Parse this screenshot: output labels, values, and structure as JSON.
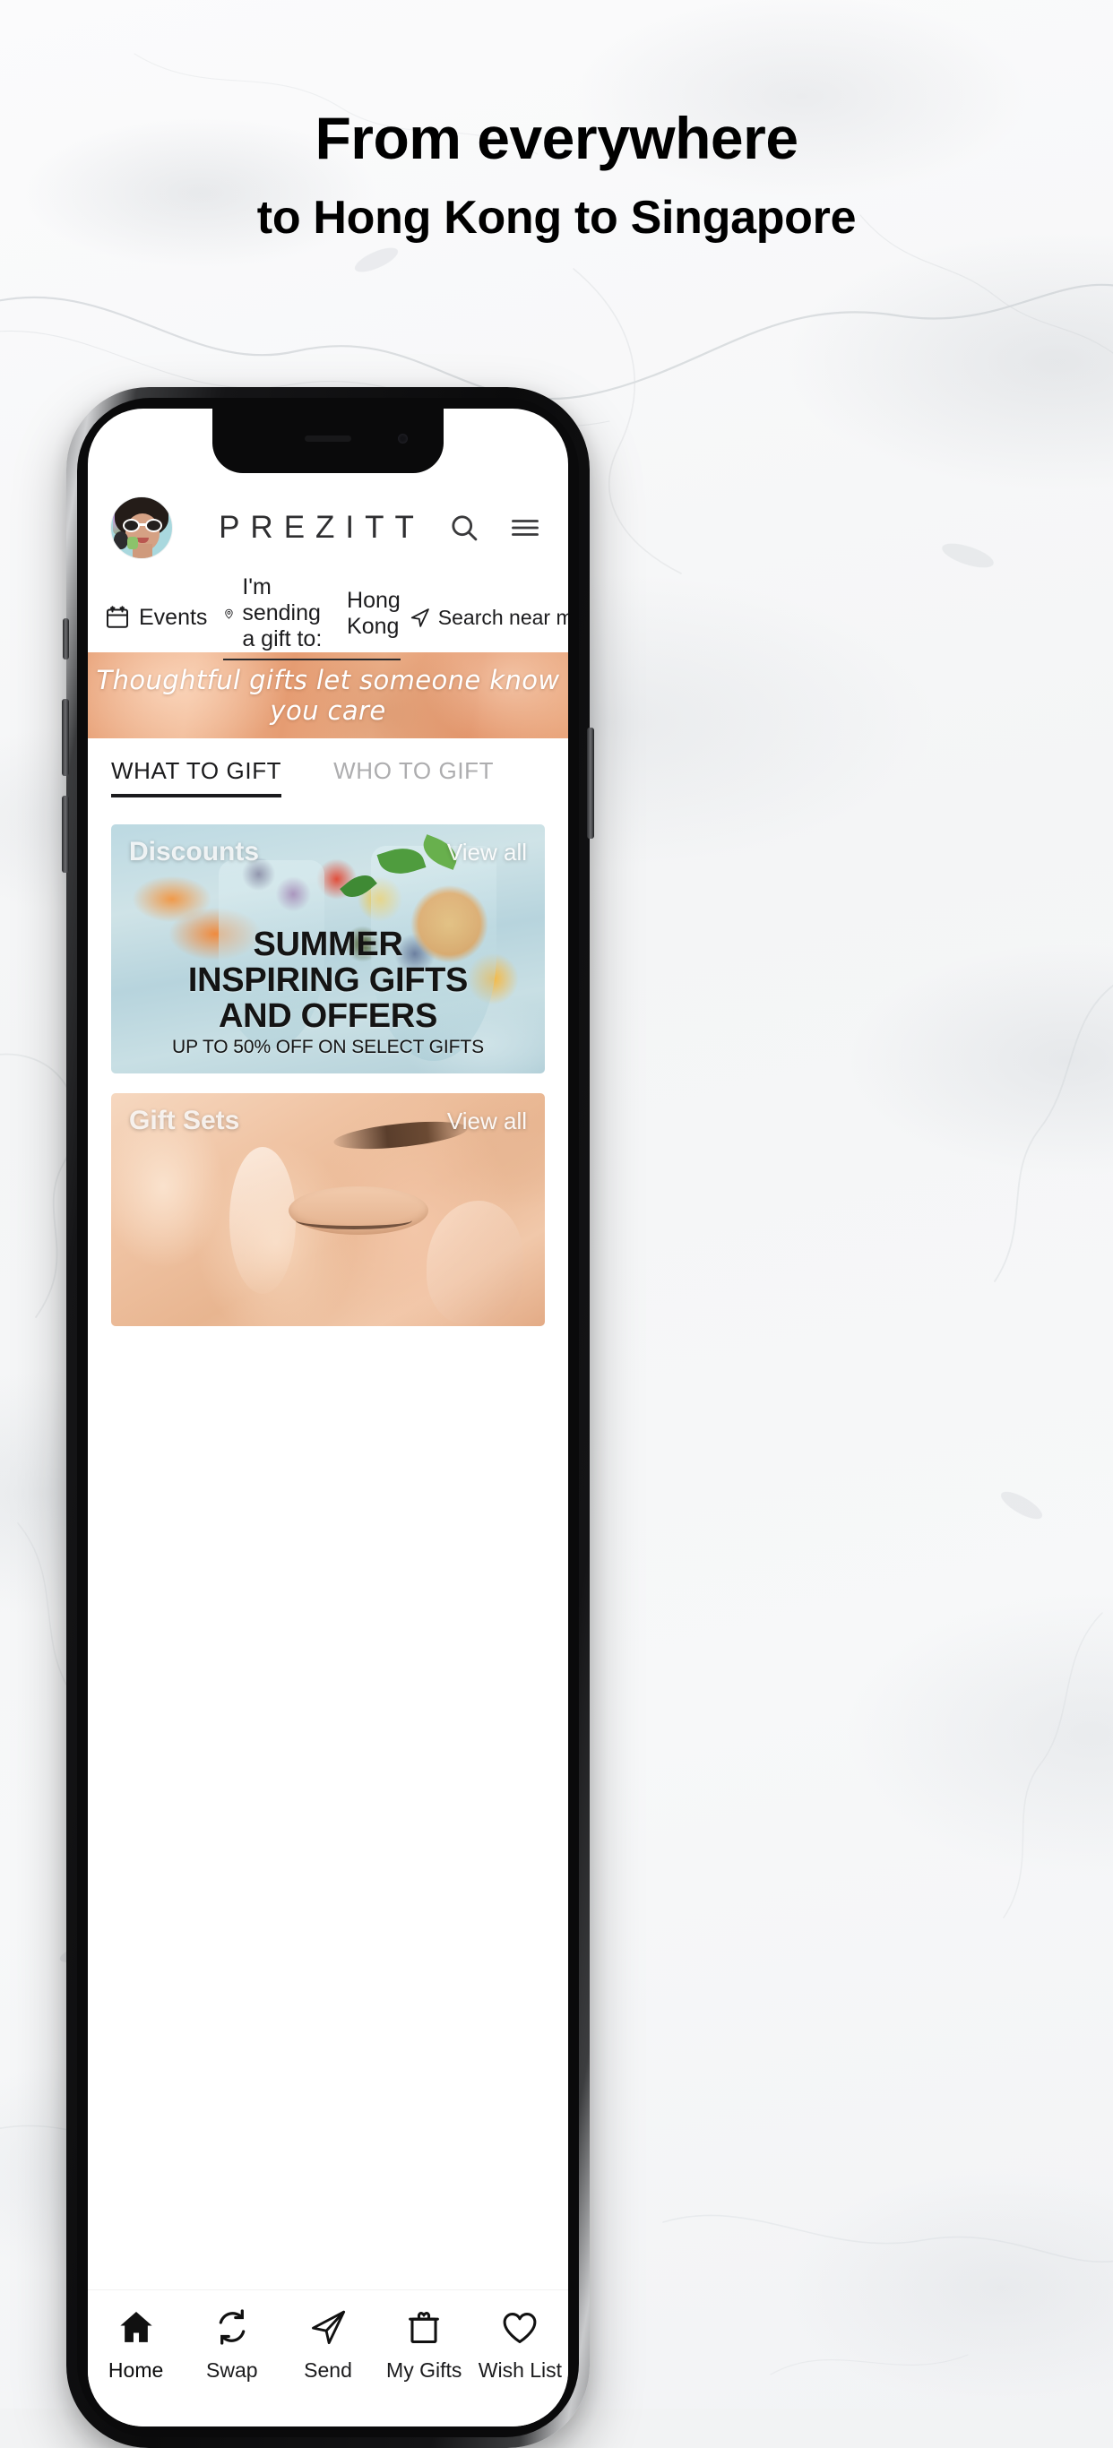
{
  "page": {
    "headline_line1": "From everywhere",
    "headline_line2": "to Hong Kong to Singapore"
  },
  "app": {
    "brand": "PREZITT",
    "avatar_name": "user-avatar",
    "header_icons": {
      "search": "search-icon",
      "menu": "hamburger-menu-icon"
    },
    "location_bar": {
      "events_label": "Events",
      "events_icon": "calendar-icon",
      "sending_label": "I'm sending a gift to:",
      "sending_city": "Hong Kong",
      "sending_icon": "location-pin-icon",
      "near_me_label": "Search near me",
      "near_me_icon": "navigation-arrow-icon"
    },
    "promo_banner": {
      "text": "Thoughtful gifts let someone know you care"
    },
    "tabs": [
      {
        "label": "WHAT TO GIFT",
        "active": true
      },
      {
        "label": "WHO TO GIFT",
        "active": false
      }
    ],
    "cards": [
      {
        "title": "Discounts",
        "view_all": "View all",
        "caption_line1": "SUMMER",
        "caption_line2": "INSPIRING GIFTS",
        "caption_line3": "AND OFFERS",
        "caption_line4": "UP TO 50% OFF ON SELECT GIFTS"
      },
      {
        "title": "Gift Sets",
        "view_all": "View all"
      }
    ],
    "bottom_nav": [
      {
        "label": "Home",
        "icon": "home-icon",
        "active": true
      },
      {
        "label": "Swap",
        "icon": "swap-icon",
        "active": false
      },
      {
        "label": "Send",
        "icon": "paper-plane-icon",
        "active": false
      },
      {
        "label": "My Gifts",
        "icon": "gift-box-icon",
        "active": false
      },
      {
        "label": "Wish List",
        "icon": "heart-icon",
        "active": false
      }
    ]
  },
  "colors": {
    "background": "#f4f5f6",
    "text_primary": "#1b1b1d",
    "text_muted": "#adadaf",
    "promo_accent": "#e8a279",
    "phone_frame": "#0b0b0c"
  }
}
